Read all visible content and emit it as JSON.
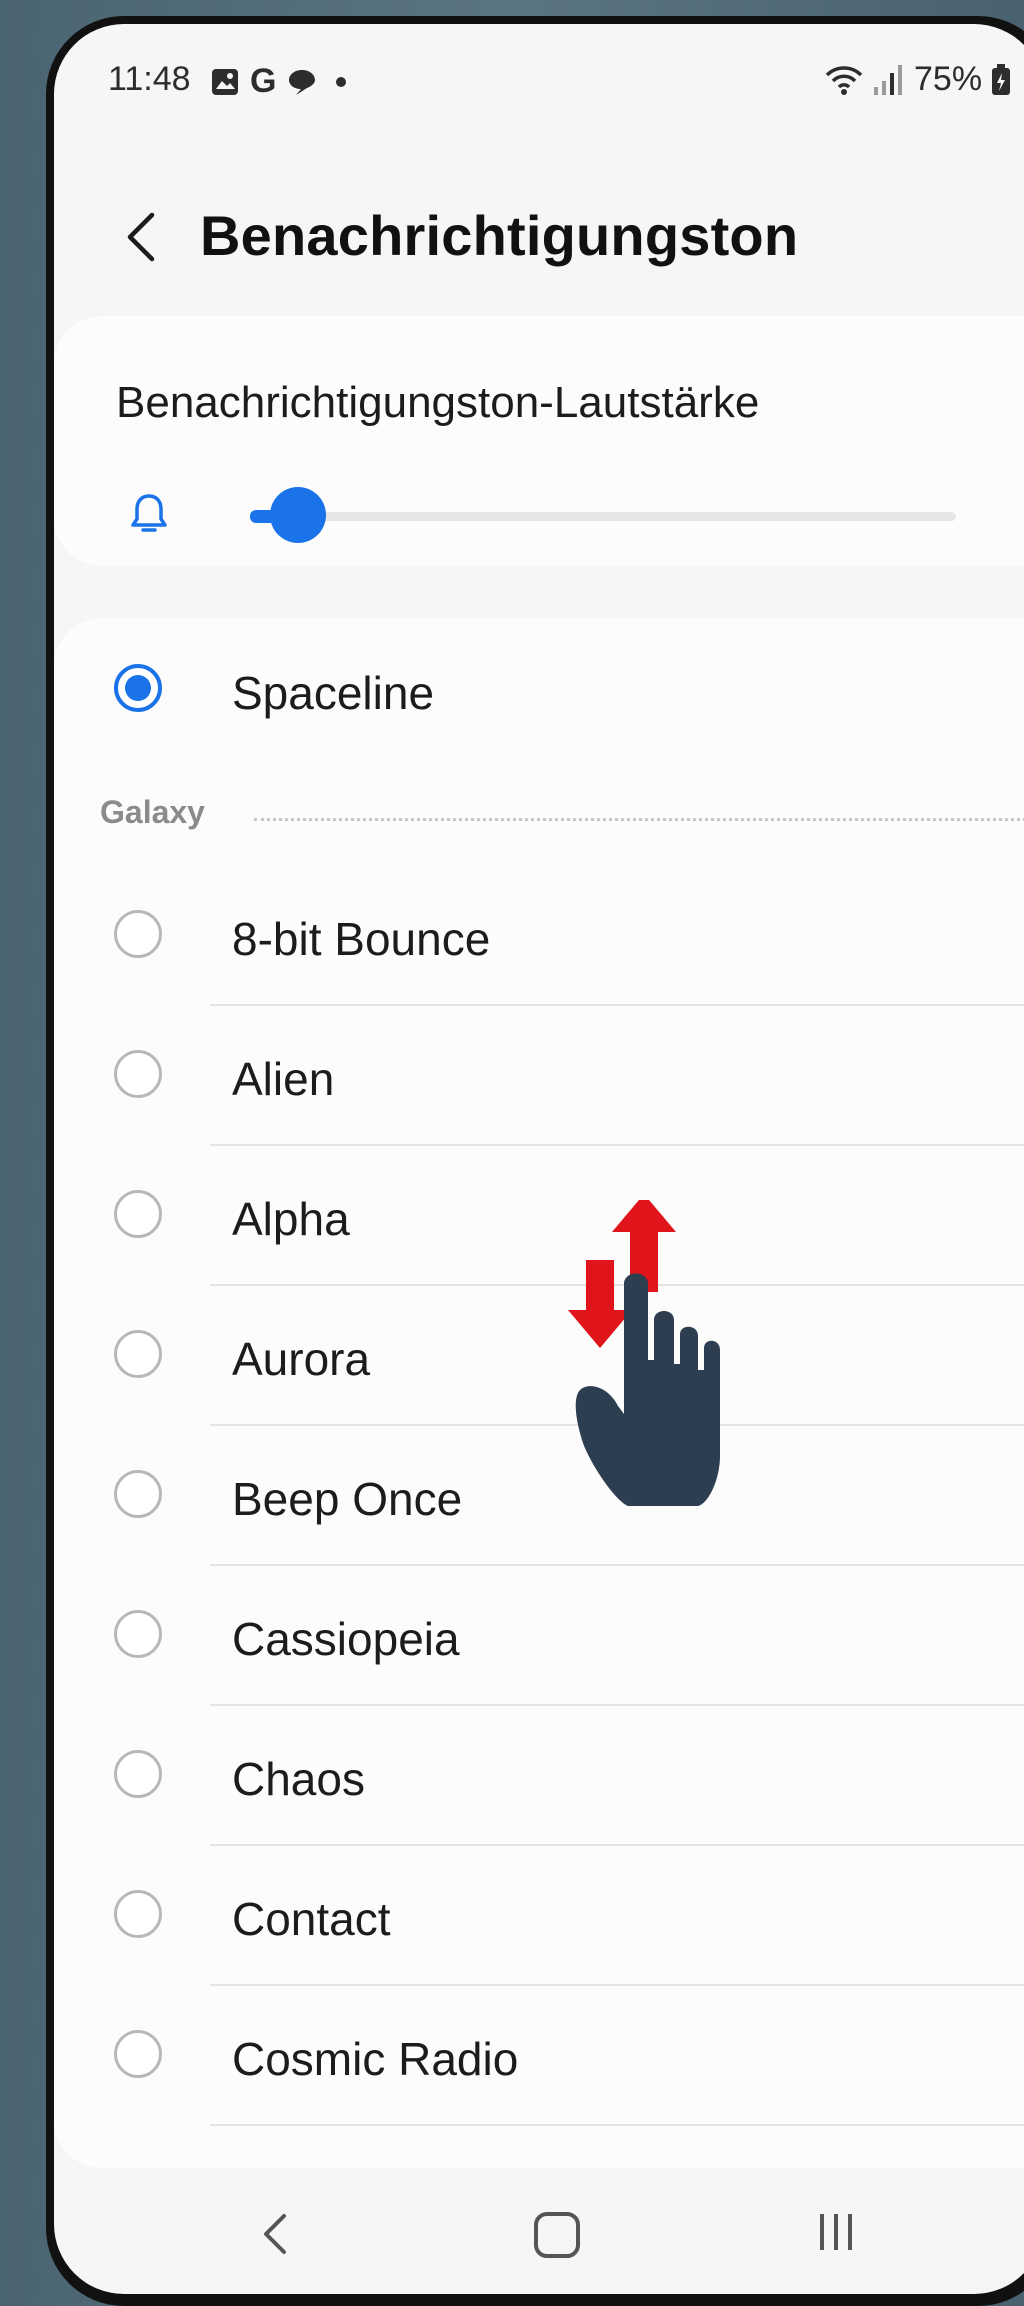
{
  "status_bar": {
    "time": "11:48",
    "battery": "75%",
    "notification_icons": [
      "gallery-icon",
      "google-icon",
      "message-icon"
    ]
  },
  "header": {
    "title": "Benachrichtigungston"
  },
  "volume": {
    "label": "Benachrichtigungston-Lautstärke",
    "level_fraction": 0.06
  },
  "ringtones": {
    "selected": "Spaceline",
    "section_label": "Galaxy",
    "items": [
      "8-bit Bounce",
      "Alien",
      "Alpha",
      "Aurora",
      "Beep Once",
      "Cassiopeia",
      "Chaos",
      "Contact",
      "Cosmic Radio"
    ]
  },
  "colors": {
    "accent": "#1a73e8",
    "gesture_arrow": "#e0141b",
    "gesture_hand": "#2d3e50"
  },
  "gesture": {
    "type": "swipe-vertical"
  }
}
